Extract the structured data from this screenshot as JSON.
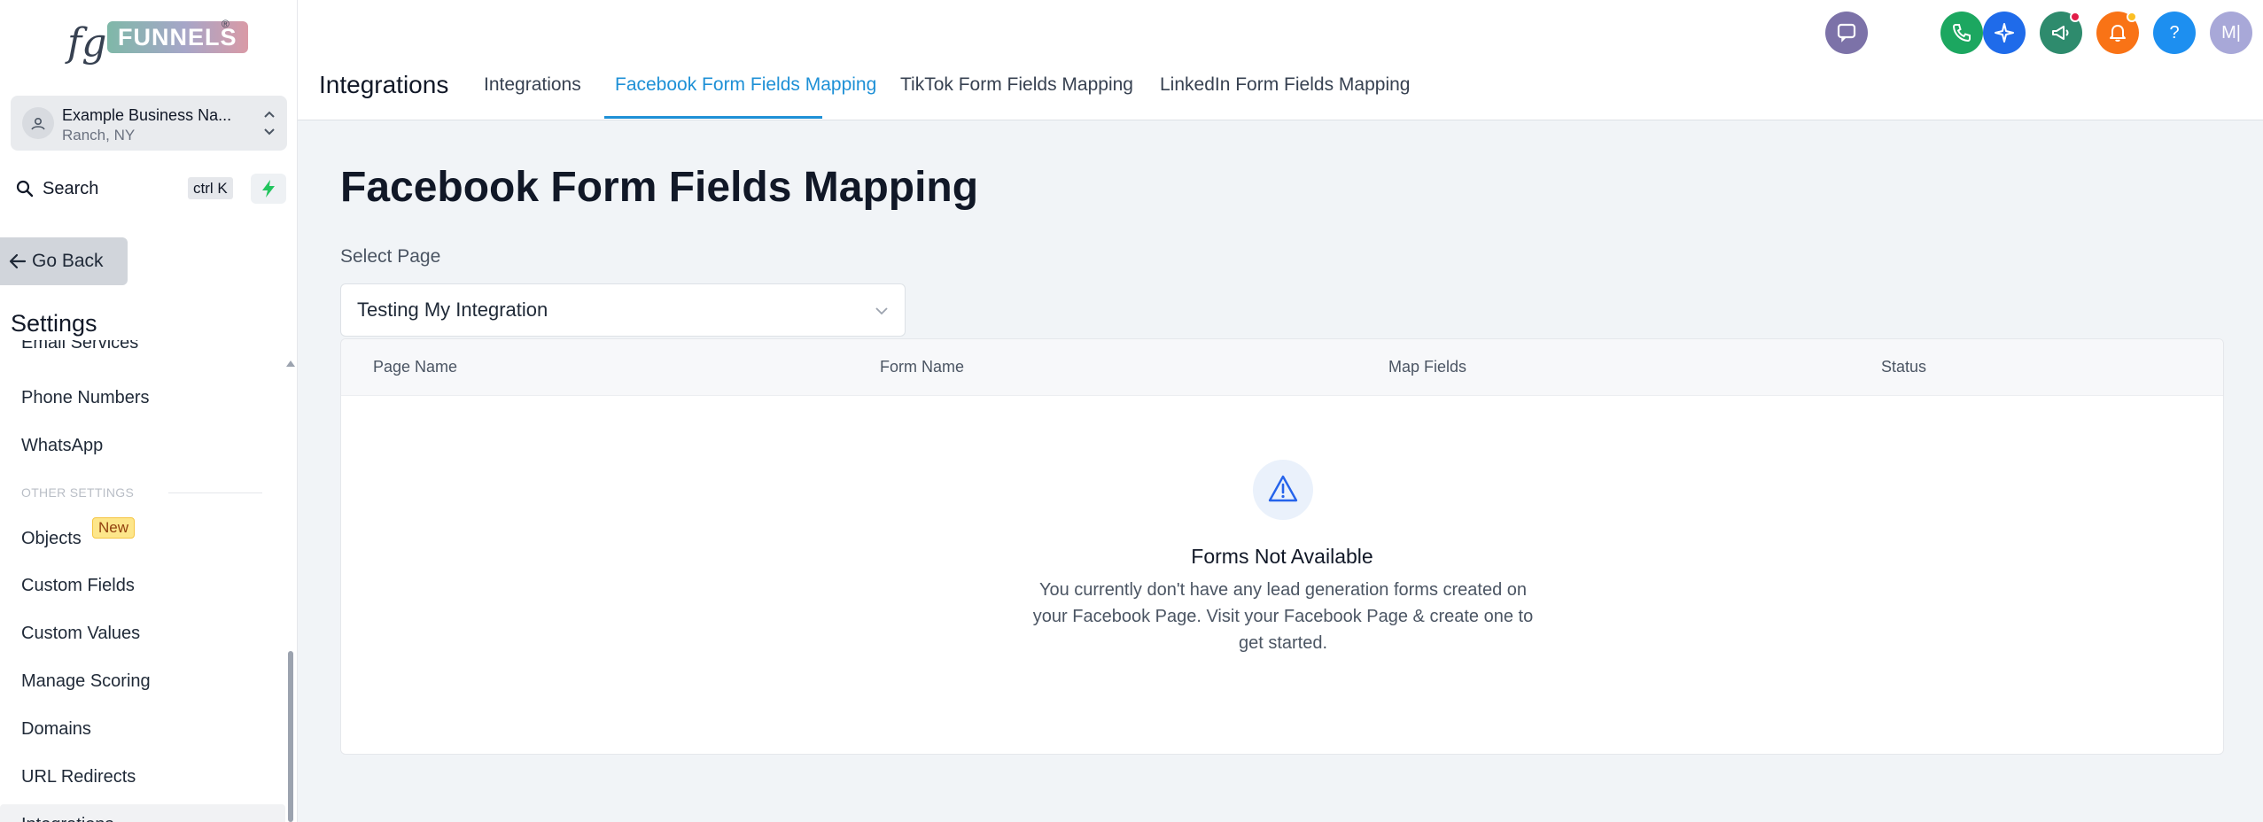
{
  "logo": {
    "prefix": "fg",
    "brand": "FUNNELS",
    "reg": "®"
  },
  "account": {
    "name": "Example Business Na...",
    "location": "Ranch, NY"
  },
  "search": {
    "label": "Search",
    "shortcut": "ctrl K"
  },
  "go_back": "Go Back",
  "settings_title": "Settings",
  "sidebar": {
    "items_top": [
      "Email Services",
      "Phone Numbers",
      "WhatsApp"
    ],
    "section_label": "OTHER SETTINGS",
    "objects": {
      "label": "Objects",
      "badge": "New"
    },
    "items": [
      "Custom Fields",
      "Custom Values",
      "Manage Scoring",
      "Domains",
      "URL Redirects",
      "Integrations"
    ]
  },
  "topbar": {
    "icons": [
      {
        "name": "chat-icon",
        "color": "#7c72a8"
      },
      {
        "name": "phone-icon",
        "color": "#1ca760"
      },
      {
        "name": "sparkle-icon",
        "color": "#1f6bea"
      },
      {
        "name": "megaphone-icon",
        "color": "#2e8b6d",
        "dot_color": "#e11d48"
      },
      {
        "name": "bell-icon",
        "color": "#f97316",
        "dot_color": "#fbbf24"
      },
      {
        "name": "help-icon",
        "color": "#1d8ff0",
        "glyph": "?"
      },
      {
        "name": "avatar",
        "color": "#a8a8d8",
        "initials": "M|"
      }
    ]
  },
  "tabs": {
    "title": "Integrations",
    "items": [
      {
        "label": "Integrations",
        "active": false
      },
      {
        "label": "Facebook Form Fields Mapping",
        "active": true
      },
      {
        "label": "TikTok Form Fields Mapping",
        "active": false
      },
      {
        "label": "LinkedIn Form Fields Mapping",
        "active": false
      }
    ]
  },
  "main": {
    "title": "Facebook Form Fields Mapping",
    "select_label": "Select Page",
    "select_value": "Testing My Integration",
    "columns": [
      "Page Name",
      "Form Name",
      "Map Fields",
      "Status"
    ],
    "empty_title": "Forms Not Available",
    "empty_desc": "You currently don't have any lead generation forms created on your Facebook Page. Visit your Facebook Page & create one to get started."
  },
  "colors": {
    "accent": "#1e90d6",
    "page_bg": "#f1f4f7",
    "bolt": "#22c55e"
  }
}
